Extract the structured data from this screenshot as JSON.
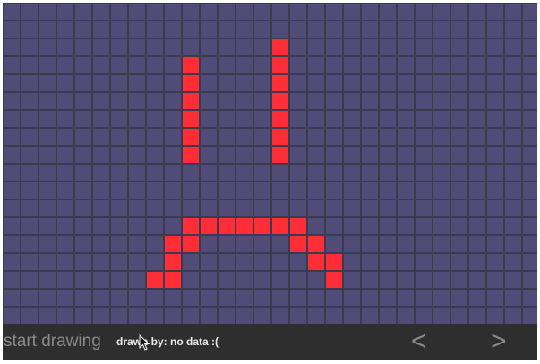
{
  "grid": {
    "columns": 30,
    "rows": 18,
    "cell_color": "#504c77",
    "line_color": "#3b3a4e",
    "active_color": "#ff2e36",
    "active_cells": [
      [
        10,
        3
      ],
      [
        10,
        4
      ],
      [
        10,
        5
      ],
      [
        10,
        6
      ],
      [
        10,
        7
      ],
      [
        10,
        8
      ],
      [
        15,
        2
      ],
      [
        15,
        3
      ],
      [
        15,
        4
      ],
      [
        15,
        5
      ],
      [
        15,
        6
      ],
      [
        15,
        7
      ],
      [
        15,
        8
      ],
      [
        10,
        12
      ],
      [
        11,
        12
      ],
      [
        12,
        12
      ],
      [
        13,
        12
      ],
      [
        14,
        12
      ],
      [
        15,
        12
      ],
      [
        16,
        12
      ],
      [
        9,
        13
      ],
      [
        10,
        13
      ],
      [
        16,
        13
      ],
      [
        17,
        13
      ],
      [
        9,
        14
      ],
      [
        17,
        14
      ],
      [
        18,
        14
      ],
      [
        8,
        15
      ],
      [
        9,
        15
      ],
      [
        18,
        15
      ]
    ]
  },
  "bottombar": {
    "start_label": "start drawing",
    "drawn_by_text": "drawn by: no data :(",
    "prev_label": "<",
    "next_label": ">"
  }
}
